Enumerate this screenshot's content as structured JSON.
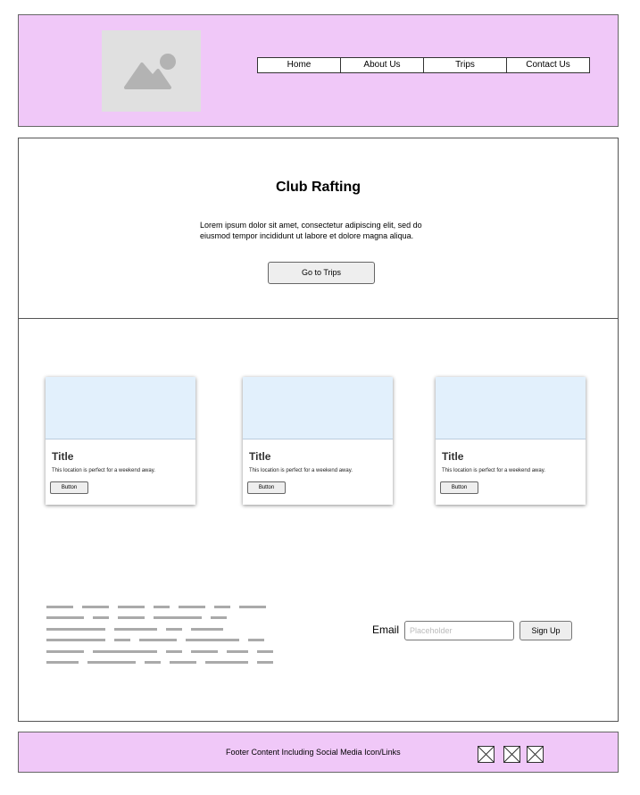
{
  "header": {
    "logo": "image-placeholder-icon",
    "nav": [
      "Home",
      "About Us",
      "Trips",
      "Contact Us"
    ]
  },
  "hero": {
    "title": "Club Rafting",
    "text": "Lorem ipsum dolor sit amet, consectetur adipiscing elit, sed do eiusmod tempor incididunt ut labore et dolore magna aliqua.",
    "button": "Go to Trips"
  },
  "cards": [
    {
      "title": "Title",
      "text": "This location is perfect for a weekend away.",
      "button": "Button"
    },
    {
      "title": "Title",
      "text": "This location is perfect for a weekend away.",
      "button": "Button"
    },
    {
      "title": "Title",
      "text": "This location is perfect for a weekend away.",
      "button": "Button"
    }
  ],
  "signup": {
    "label": "Email",
    "placeholder": "Placeholder",
    "button": "Sign Up"
  },
  "footer": {
    "text": "Footer Content Including Social Media Icon/Links",
    "icons": [
      "social-icon",
      "social-icon",
      "social-icon"
    ]
  },
  "colors": {
    "header_bg": "#f0c8f8",
    "card_image": "#e2f0fc"
  }
}
